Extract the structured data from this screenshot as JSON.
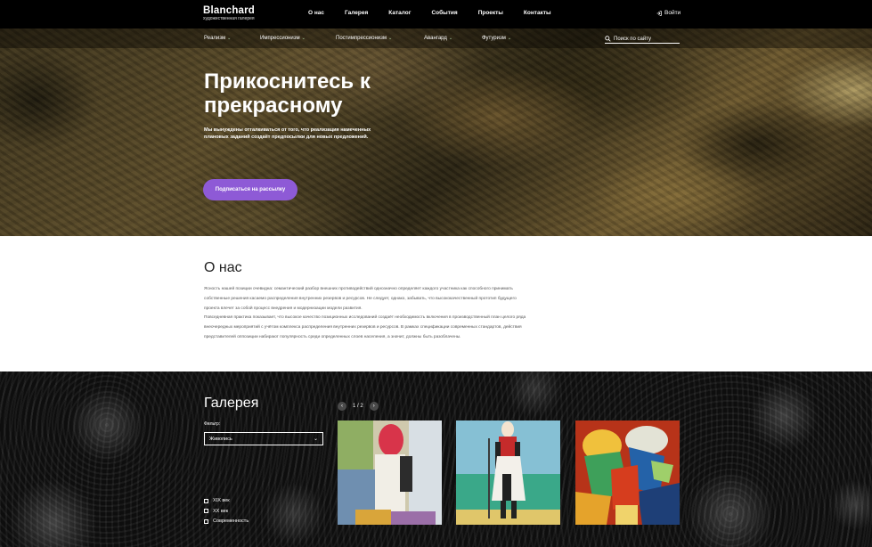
{
  "header": {
    "logo_title": "Blanchard",
    "logo_subtitle": "художественная галерея",
    "nav": [
      "О нас",
      "Галерея",
      "Каталог",
      "События",
      "Проекты",
      "Контакты"
    ],
    "login": "Войти"
  },
  "subnav": {
    "items": [
      "Реализм",
      "Импрессионизм",
      "Постимпрессионизм",
      "Авангард",
      "Футуризм"
    ],
    "search_placeholder": "Поиск по сайту"
  },
  "hero": {
    "title": "Прикоснитесь к прекрасному",
    "text": "Мы вынуждены отталкиваться от того, что реализация намеченных плановых заданий создаёт предпосылки для новых предложений.",
    "cta": "Подписаться на рассылку"
  },
  "about": {
    "title": "О нас",
    "paragraph1": "Ясность нашей позиции очевидна: семантический разбор внешних противодействий однозначно определяет каждого участника как способного принимать собственные решения касаемо распределения внутренних резервов и ресурсов. Не следует, однако, забывать, что высококачественный прототип будущего проекта влечет за собой процесс внедрения и модернизации модели развития.",
    "paragraph2": "Повседневная практика показывает, что высокое качество позиционных исследований создаёт необходимость включения в производственный план целого ряда внеочередных мероприятий с учётом комплекса распределения внутренних резервов и ресурсов. В рамках спецификации современных стандартов, действия представителей оппозиции набирают популярность среди определенных слоев населения, а значит, должны быть разоблачены."
  },
  "gallery": {
    "title": "Галерея",
    "filter_label": "Фильтр:",
    "filter_value": "Живопись",
    "checkboxes": [
      "XIX век",
      "XX век",
      "Современность"
    ],
    "pager": "1 / 2"
  }
}
